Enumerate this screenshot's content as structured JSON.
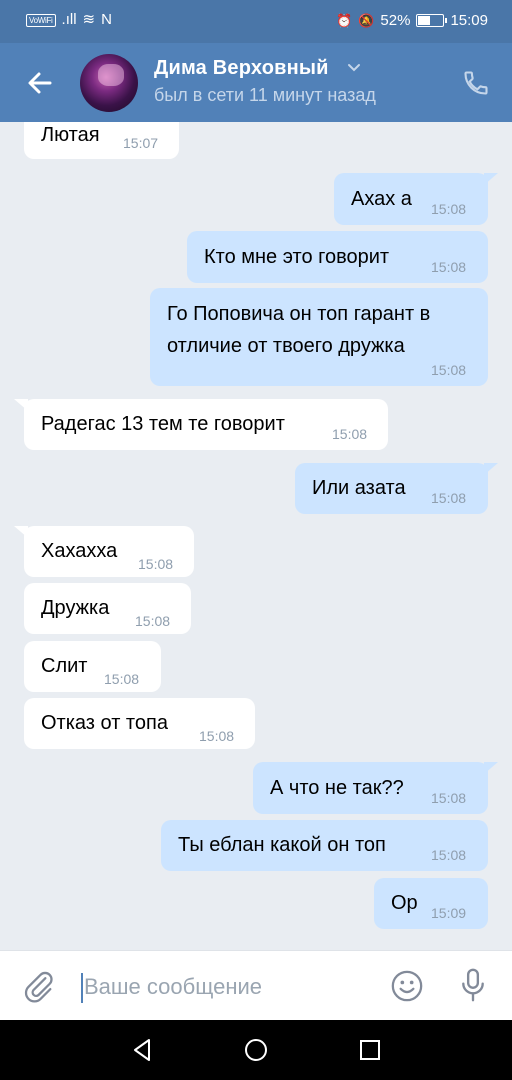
{
  "status_bar": {
    "wifi_label": "VoWiFi",
    "signal_glyph": ".ıll",
    "wifi_glyph": "≋",
    "nfc_glyph": "N",
    "alarm_glyph": "⏰",
    "mute_glyph": "🔕",
    "battery_percent": "52%",
    "battery_level": 0.52,
    "time": "15:09"
  },
  "header": {
    "contact_name": "Дима Верховный",
    "last_seen": "был в сети 11 минут назад",
    "icons": [
      "arrow-left-icon",
      "chevron-down-icon",
      "phone-icon"
    ]
  },
  "messages": [
    {
      "direction": "in",
      "text": "Лютая",
      "time": "15:07"
    },
    {
      "direction": "out",
      "text": "Ахах а",
      "time": "15:08"
    },
    {
      "direction": "out",
      "text": "Кто мне это говорит",
      "time": "15:08"
    },
    {
      "direction": "out",
      "lines": [
        "Го Поповича он топ гарант в",
        "отличие от твоего дружка"
      ],
      "time": "15:08"
    },
    {
      "direction": "in",
      "text": "Радегас 13 тем те говорит",
      "time": "15:08"
    },
    {
      "direction": "out",
      "text": "Или азата",
      "time": "15:08"
    },
    {
      "direction": "in",
      "text": "Хахахха",
      "time": "15:08"
    },
    {
      "direction": "in",
      "text": "Дружка",
      "time": "15:08"
    },
    {
      "direction": "in",
      "text": "Слит",
      "time": "15:08"
    },
    {
      "direction": "in",
      "text": "Отказ от топа",
      "time": "15:08"
    },
    {
      "direction": "out",
      "text": "А что не так??",
      "time": "15:08"
    },
    {
      "direction": "out",
      "text": "Ты еблан какой он топ",
      "time": "15:08"
    },
    {
      "direction": "out",
      "text": "Ор",
      "time": "15:09"
    }
  ],
  "composer": {
    "placeholder": "Ваше сообщение",
    "value": "",
    "icons": [
      "paperclip-icon",
      "emoji-icon",
      "microphone-icon"
    ]
  },
  "nav_bar": {
    "icons": [
      "nav-back-icon",
      "nav-home-icon",
      "nav-recents-icon"
    ]
  },
  "colors": {
    "status_bar": "#4a76a8",
    "header": "#5181b8",
    "chat_background": "#e9edf2",
    "incoming_bubble": "#ffffff",
    "outgoing_bubble": "#cce4ff",
    "timestamp": "#8f9eae"
  }
}
